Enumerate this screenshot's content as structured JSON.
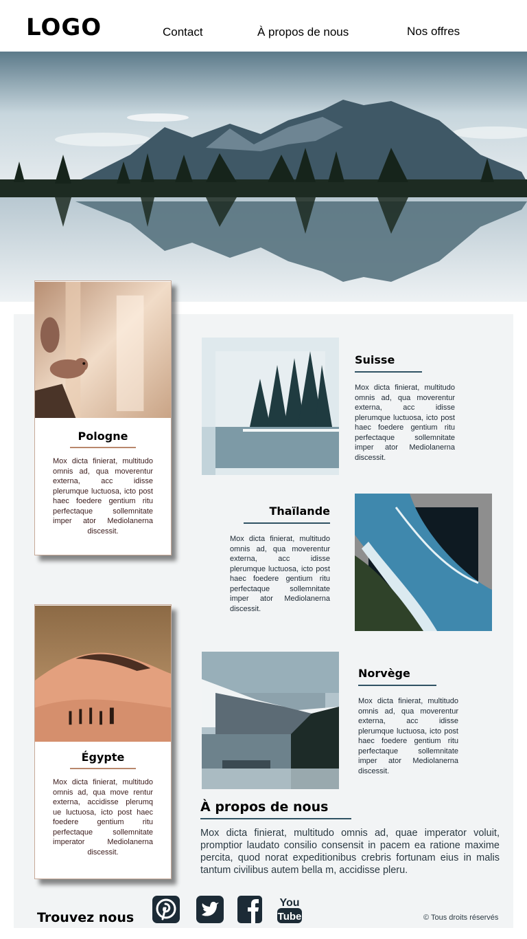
{
  "header": {
    "logo": "LOGO",
    "nav": [
      "Contact",
      "À propos de nous",
      "Nos offres"
    ]
  },
  "hero": {
    "image": "mountain-lake-image"
  },
  "cards": [
    {
      "title": "Pologne",
      "image": "squirrel-image",
      "text": "Mox dicta finierat, multitudo omnis ad, qua moverentur externa, acc idisse plerumque luctuosa, icto post haec foedere gentium ritu perfectaque sollemnitate imper ator Mediolanerna discessit."
    },
    {
      "title": "Égypte",
      "image": "desert-camels-image",
      "text": "Mox dicta finierat, multitudo omnis ad, qua move rentur externa, accidisse plerumq ue luctuosa, icto post haec foedere gentium ritu perfectaque sollemnitate imperator Mediolanerna discessit."
    }
  ],
  "destinations": [
    {
      "title": "Suisse",
      "image": "snowy-forest-image",
      "text": "Mox dicta finierat, multitudo omnis ad, qua moverentur externa, acc idisse plerumque luctuosa, icto post haec foedere gentium ritu perfectaque sollemnitate imper ator Mediolanerna discessit."
    },
    {
      "title": "Thaïlande",
      "image": "aerial-coast-image",
      "text": "Mox dicta finierat, multitudo omnis ad, qua moverentur externa, acc idisse plerumque luctuosa, icto post haec foedere gentium ritu perfectaque sollemnitate imper ator Mediolanerna discessit."
    },
    {
      "title": "Norvège",
      "image": "fjord-town-image",
      "text": "Mox dicta finierat, multitudo omnis ad, qua moverentur externa, acc idisse plerumque luctuosa, icto post haec foedere gentium ritu perfectaque sollemnitate imper ator Mediolanerna discessit."
    }
  ],
  "about": {
    "title": "À propos de nous",
    "text": "Mox dicta finierat, multitudo omnis ad, quae imperator voluit, promptior laudato consilio consensit in pacem ea ratione maxime percita, quod norat expeditionibus crebris fortunam eius in malis tantum civilibus autem bella m, accidisse pleru."
  },
  "footer": {
    "find_us": "Trouvez nous",
    "social": [
      "pinterest-icon",
      "twitter-icon",
      "facebook-icon",
      "youtube-icon"
    ],
    "youtube_you": "You",
    "youtube_tube": "Tube",
    "copyright": "© Tous droits réservés"
  },
  "colors": {
    "panel": "#f2f4f5",
    "accent_rule": "#2f5263",
    "card_rule": "#b8876c",
    "social": "#1c2b36"
  }
}
